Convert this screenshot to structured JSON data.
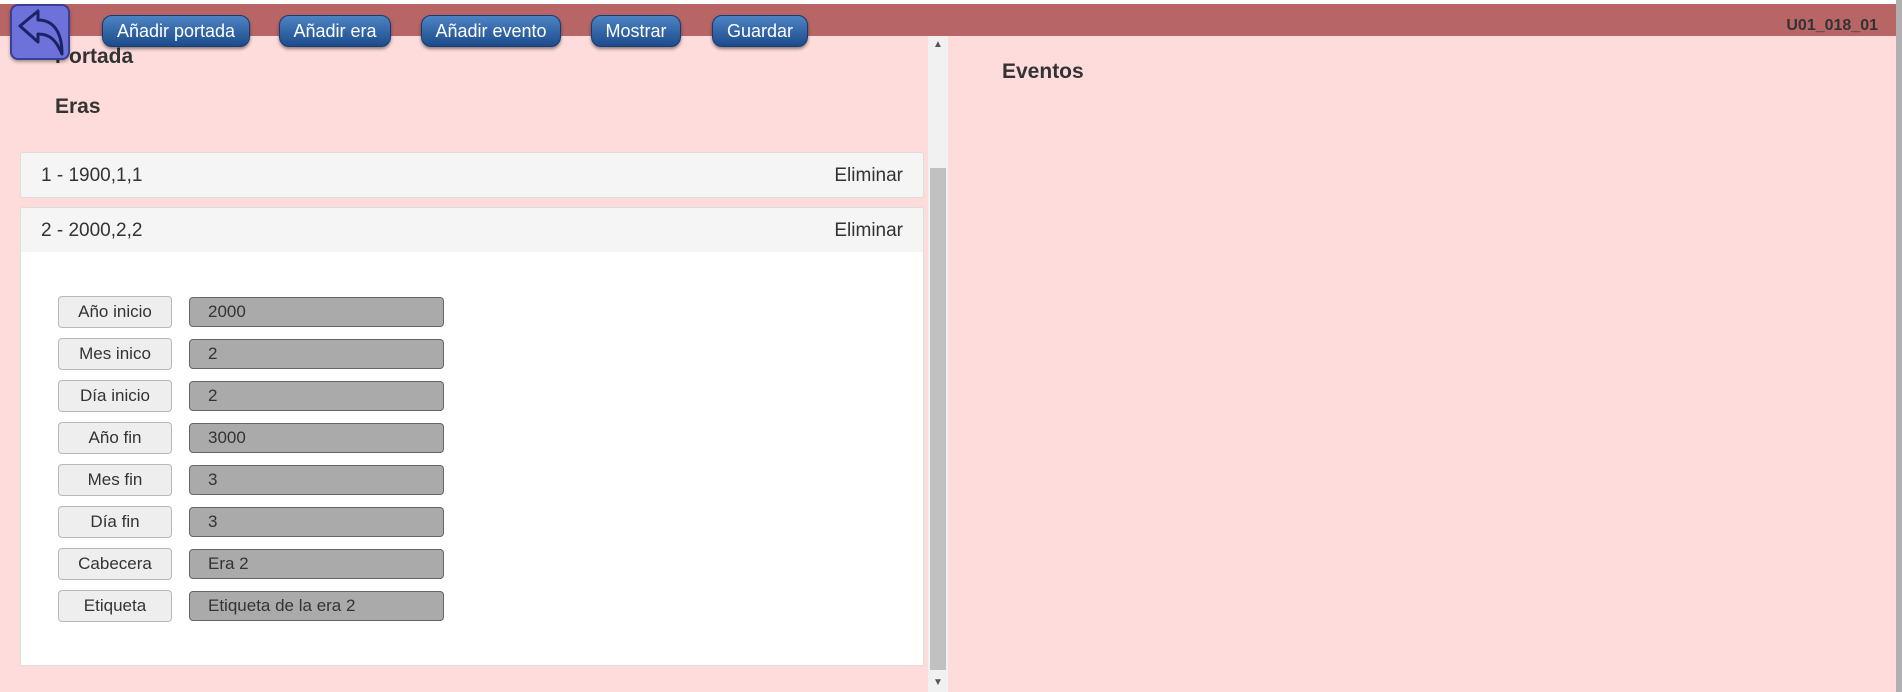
{
  "toolbar": {
    "buttons": [
      "Añadir portada",
      "Añadir era",
      "Añadir evento",
      "Mostrar",
      "Guardar"
    ],
    "doc_id": "U01_018_01",
    "back_icon": "back-arrow-icon"
  },
  "left": {
    "portada_title": "Portada",
    "eras_title": "Eras",
    "eras": [
      {
        "title": "1 - 1900,1,1",
        "delete_label": "Eliminar"
      },
      {
        "title": "2 - 2000,2,2",
        "delete_label": "Eliminar"
      }
    ],
    "fields": [
      {
        "label": "Año inicio",
        "value": "2000"
      },
      {
        "label": "Mes inico",
        "value": "2"
      },
      {
        "label": "Día inicio",
        "value": "2"
      },
      {
        "label": "Año fin",
        "value": "3000"
      },
      {
        "label": "Mes fin",
        "value": "3"
      },
      {
        "label": "Día fin",
        "value": "3"
      },
      {
        "label": "Cabecera",
        "value": "Era 2"
      },
      {
        "label": "Etiqueta",
        "value": "Etiqueta de la era 2"
      }
    ]
  },
  "right": {
    "eventos_title": "Eventos"
  },
  "colors": {
    "topbar": "#b86565",
    "background": "#ffdcdc",
    "button": "#2a5ea5",
    "input_bg": "#aaaaaa"
  }
}
